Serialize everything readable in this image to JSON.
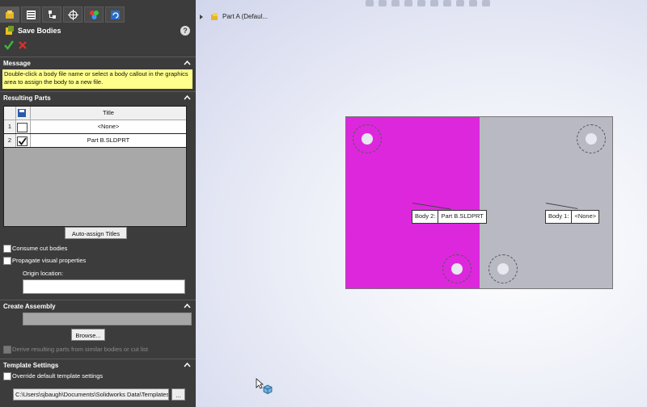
{
  "panel": {
    "title": "Save Bodies",
    "help": "?",
    "message": {
      "header": "Message",
      "text": "Double-click a body file name or select a body callout in the graphics area to assign the body to a new file."
    },
    "resulting_parts": {
      "header": "Resulting Parts",
      "column_title": "Title",
      "rows": [
        {
          "num": "1",
          "checked": false,
          "title": "<None>"
        },
        {
          "num": "2",
          "checked": true,
          "title": "Part B.SLDPRT"
        }
      ],
      "auto_assign_label": "Auto-assign Titles",
      "consume_cut_label": "Consume cut bodies",
      "propagate_label": "Propagate visual properties",
      "origin_location_label": "Origin location:"
    },
    "create_assembly": {
      "header": "Create Assembly",
      "browse_label": "Browse...",
      "derive_label": "Derive resulting parts from similar bodies or cut list"
    },
    "template_settings": {
      "header": "Template Settings",
      "override_label": "Override default template settings",
      "path_value": "C:\\Users\\sjbaugh\\Documents\\Solidworks Data\\Templates",
      "browse_small_label": "..."
    }
  },
  "graphics": {
    "tree_item": "Part A (Defaul...",
    "callouts": [
      {
        "label": "Body 2:",
        "value": "Part B.SLDPRT"
      },
      {
        "label": "Body 1:",
        "value": "<None>"
      }
    ]
  },
  "colors": {
    "panel_bg": "#3c3c3c",
    "body2": "#dd27dd",
    "body1": "#b8b9c3",
    "message_bg": "#ffff8c"
  }
}
